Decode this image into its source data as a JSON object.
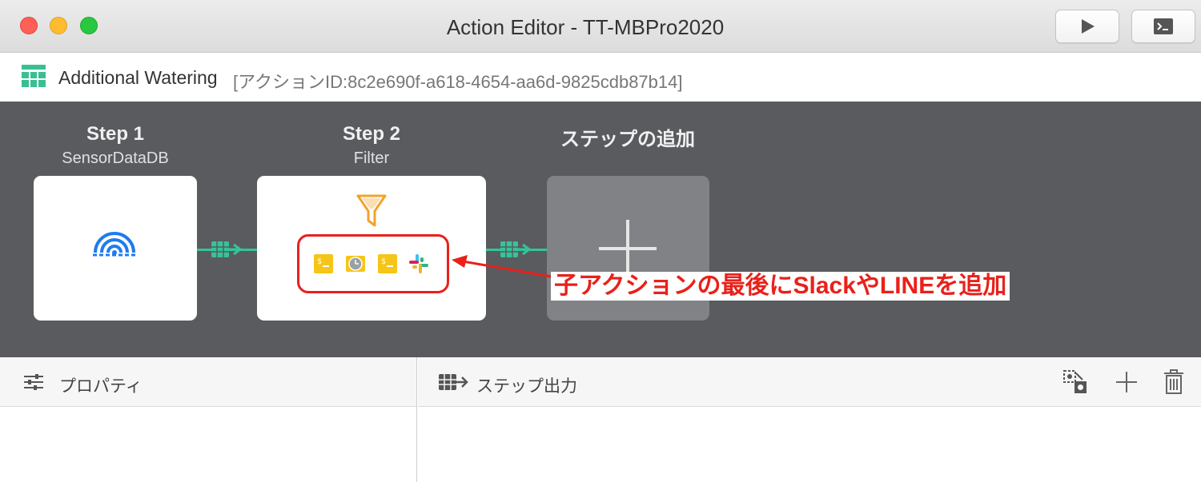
{
  "window": {
    "title": "Action Editor - TT-MBPro2020"
  },
  "toolbar": {
    "run_icon": "play-icon",
    "console_icon": "terminal-icon"
  },
  "action": {
    "name": "Additional Watering",
    "id_label": "[アクションID:8c2e690f-a618-4654-aa6d-9825cdb87b14]"
  },
  "pipeline": {
    "steps": [
      {
        "title": "Step 1",
        "subtitle": "SensorDataDB",
        "icon": "sensor-signal-icon"
      },
      {
        "title": "Step 2",
        "subtitle": "Filter",
        "icon": "filter-funnel-icon",
        "sub_actions": [
          "shell-script-icon",
          "timer-icon",
          "shell-script-icon",
          "slack-icon"
        ]
      }
    ],
    "add_step": {
      "title": "ステップの追加",
      "icon": "plus-icon"
    }
  },
  "annotation": {
    "text": "子アクションの最後にSlackやLINEを追加",
    "color": "#e8211b"
  },
  "panels": {
    "properties": {
      "title": "プロパティ",
      "icon": "sliders-icon"
    },
    "step_output": {
      "title": "ステップ出力",
      "icon": "step-output-icon",
      "actions": [
        "copy-config-icon",
        "add-icon",
        "trash-icon"
      ]
    }
  },
  "colors": {
    "pipeline_bg": "#595b5f",
    "connector": "#34c49a",
    "sensor_blue": "#1f7bf0",
    "filter_orange": "#f2a32b",
    "script_yellow": "#f5c518"
  }
}
